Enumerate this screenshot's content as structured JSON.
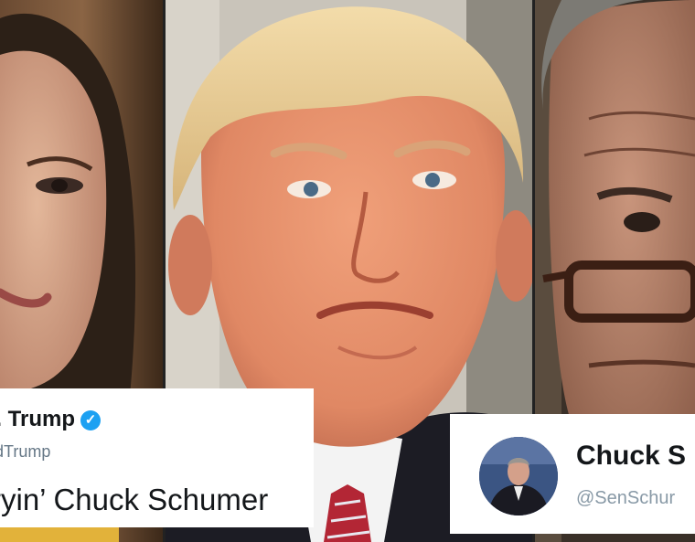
{
  "collage": {
    "panels": [
      {
        "subject": "woman-portrait"
      },
      {
        "subject": "man-portrait-center"
      },
      {
        "subject": "man-portrait-glasses"
      }
    ]
  },
  "tweet_left": {
    "display_name": "J. Trump",
    "handle": "dTrump",
    "verified_icon": "checkmark-icon",
    "text": "ryin’ Chuck Schumer"
  },
  "tweet_right": {
    "display_name": "Chuck S",
    "handle": "@SenSchur"
  },
  "colors": {
    "card_bg": "#ffffff",
    "verified_blue": "#1da1f2",
    "name_text": "#14171a",
    "handle_text": "#657786"
  }
}
